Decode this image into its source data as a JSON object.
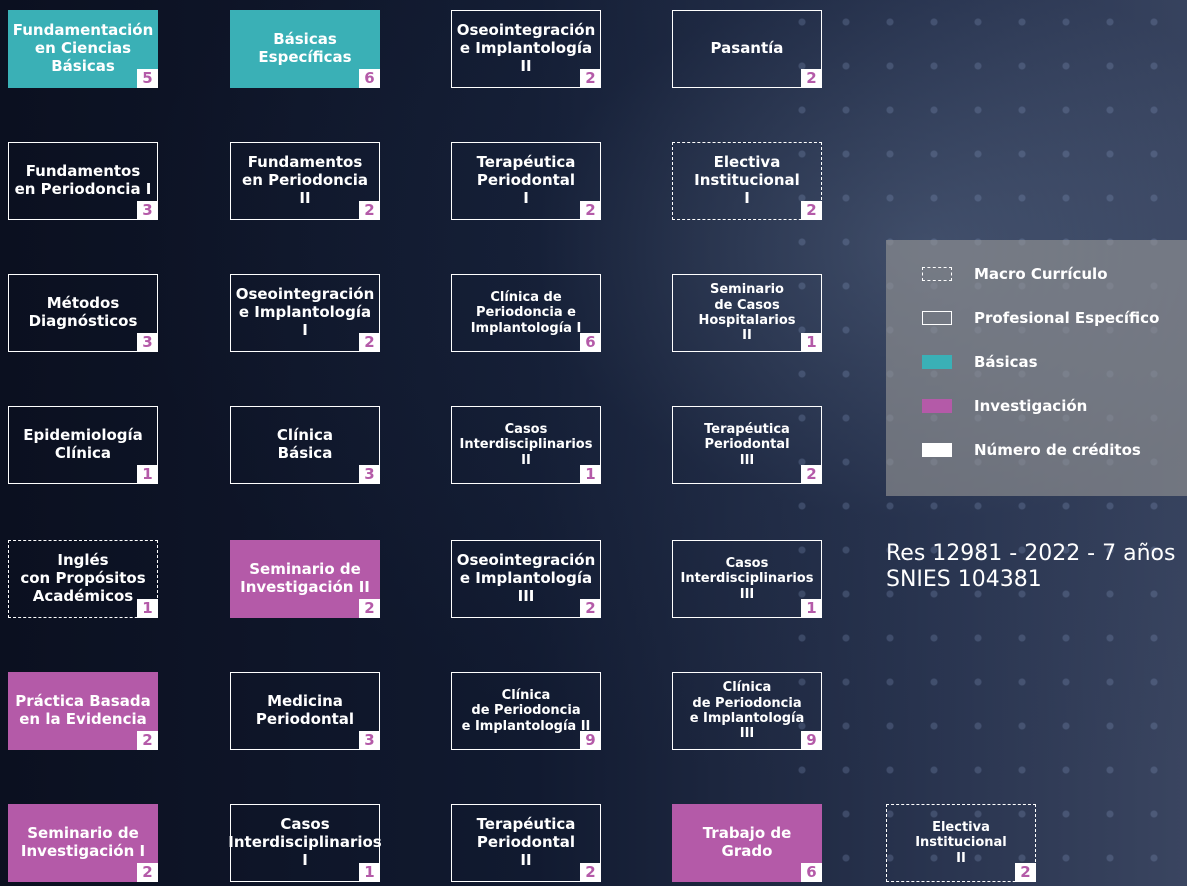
{
  "courses": [
    {
      "lines": [
        "Fundamentación",
        "en Ciencias",
        "Básicas"
      ],
      "credits": "5",
      "style": "basic",
      "col": 0,
      "row": 0
    },
    {
      "lines": [
        "Básicas",
        "Específicas"
      ],
      "credits": "6",
      "style": "basic",
      "col": 1,
      "row": 0
    },
    {
      "lines": [
        "Oseointegración",
        "e Implantología",
        "II"
      ],
      "credits": "2",
      "style": "solid",
      "col": 2,
      "row": 0
    },
    {
      "lines": [
        "Pasantía"
      ],
      "credits": "2",
      "style": "solid",
      "col": 3,
      "row": 0
    },
    {
      "lines": [
        "Fundamentos",
        "en Periodoncia I"
      ],
      "credits": "3",
      "style": "solid",
      "col": 0,
      "row": 1
    },
    {
      "lines": [
        "Fundamentos",
        "en Periodoncia",
        "II"
      ],
      "credits": "2",
      "style": "solid",
      "col": 1,
      "row": 1
    },
    {
      "lines": [
        "Terapéutica",
        "Periodontal",
        "I"
      ],
      "credits": "2",
      "style": "solid",
      "col": 2,
      "row": 1
    },
    {
      "lines": [
        "Electiva",
        "Institucional",
        "I"
      ],
      "credits": "2",
      "style": "dashed",
      "col": 3,
      "row": 1
    },
    {
      "lines": [
        "Métodos",
        "Diagnósticos"
      ],
      "credits": "3",
      "style": "solid",
      "col": 0,
      "row": 2
    },
    {
      "lines": [
        "Oseointegración",
        "e Implantología",
        "I"
      ],
      "credits": "2",
      "style": "solid",
      "col": 1,
      "row": 2
    },
    {
      "lines": [
        "Clínica de",
        "Periodoncia e",
        "Implantología I"
      ],
      "credits": "6",
      "style": "solid",
      "col": 2,
      "row": 2,
      "small": true
    },
    {
      "lines": [
        "Seminario",
        "de Casos",
        "Hospitalarios",
        "II"
      ],
      "credits": "1",
      "style": "solid",
      "col": 3,
      "row": 2,
      "small": true
    },
    {
      "lines": [
        "Epidemiología",
        "Clínica"
      ],
      "credits": "1",
      "style": "solid",
      "col": 0,
      "row": 3
    },
    {
      "lines": [
        "Clínica",
        "Básica"
      ],
      "credits": "3",
      "style": "solid",
      "col": 1,
      "row": 3
    },
    {
      "lines": [
        "Casos",
        "Interdisciplinarios",
        "II"
      ],
      "credits": "1",
      "style": "solid",
      "col": 2,
      "row": 3,
      "small": true
    },
    {
      "lines": [
        "Terapéutica",
        "Periodontal",
        "III"
      ],
      "credits": "2",
      "style": "solid",
      "col": 3,
      "row": 3,
      "small": true
    },
    {
      "lines": [
        "Inglés",
        "con Propósitos",
        "Académicos"
      ],
      "credits": "1",
      "style": "dashed",
      "col": 0,
      "row": 4
    },
    {
      "lines": [
        "Seminario de",
        "Investigación II"
      ],
      "credits": "2",
      "style": "research",
      "col": 1,
      "row": 4
    },
    {
      "lines": [
        "Oseointegración",
        "e Implantología",
        "III"
      ],
      "credits": "2",
      "style": "solid",
      "col": 2,
      "row": 4
    },
    {
      "lines": [
        "Casos",
        "Interdisciplinarios",
        "III"
      ],
      "credits": "1",
      "style": "solid",
      "col": 3,
      "row": 4,
      "small": true
    },
    {
      "lines": [
        "Práctica Basada",
        "en la Evidencia"
      ],
      "credits": "2",
      "style": "research",
      "col": 0,
      "row": 5
    },
    {
      "lines": [
        "Medicina",
        "Periodontal"
      ],
      "credits": "3",
      "style": "solid",
      "col": 1,
      "row": 5
    },
    {
      "lines": [
        "Clínica",
        "de Periodoncia",
        "e Implantología II"
      ],
      "credits": "9",
      "style": "solid",
      "col": 2,
      "row": 5,
      "small": true
    },
    {
      "lines": [
        "Clínica",
        "de Periodoncia",
        "e Implantología",
        "III"
      ],
      "credits": "9",
      "style": "solid",
      "col": 3,
      "row": 5,
      "small": true
    },
    {
      "lines": [
        "Seminario de",
        "Investigación I"
      ],
      "credits": "2",
      "style": "research",
      "col": 0,
      "row": 6
    },
    {
      "lines": [
        "Casos",
        "Interdisciplinarios",
        "I"
      ],
      "credits": "1",
      "style": "solid",
      "col": 1,
      "row": 6
    },
    {
      "lines": [
        "Terapéutica",
        "Periodontal",
        "II"
      ],
      "credits": "2",
      "style": "solid",
      "col": 2,
      "row": 6
    },
    {
      "lines": [
        "Trabajo de",
        "Grado"
      ],
      "credits": "6",
      "style": "research",
      "col": 3,
      "row": 6
    },
    {
      "lines": [
        "Electiva",
        "Institucional",
        "II"
      ],
      "credits": "2",
      "style": "dashed",
      "col": 4,
      "row": 6,
      "small": true
    }
  ],
  "legend": [
    {
      "label": "Macro Currículo",
      "swatch": "dash"
    },
    {
      "label": "Profesional Específico",
      "swatch": "solid"
    },
    {
      "label": "Básicas",
      "swatch": "teal"
    },
    {
      "label": "Investigación",
      "swatch": "purple"
    },
    {
      "label": "Número de créditos",
      "swatch": "white"
    }
  ],
  "resolution": {
    "line1": "Res 12981 - 2022 - 7 años",
    "line2": "SNIES 104381"
  }
}
